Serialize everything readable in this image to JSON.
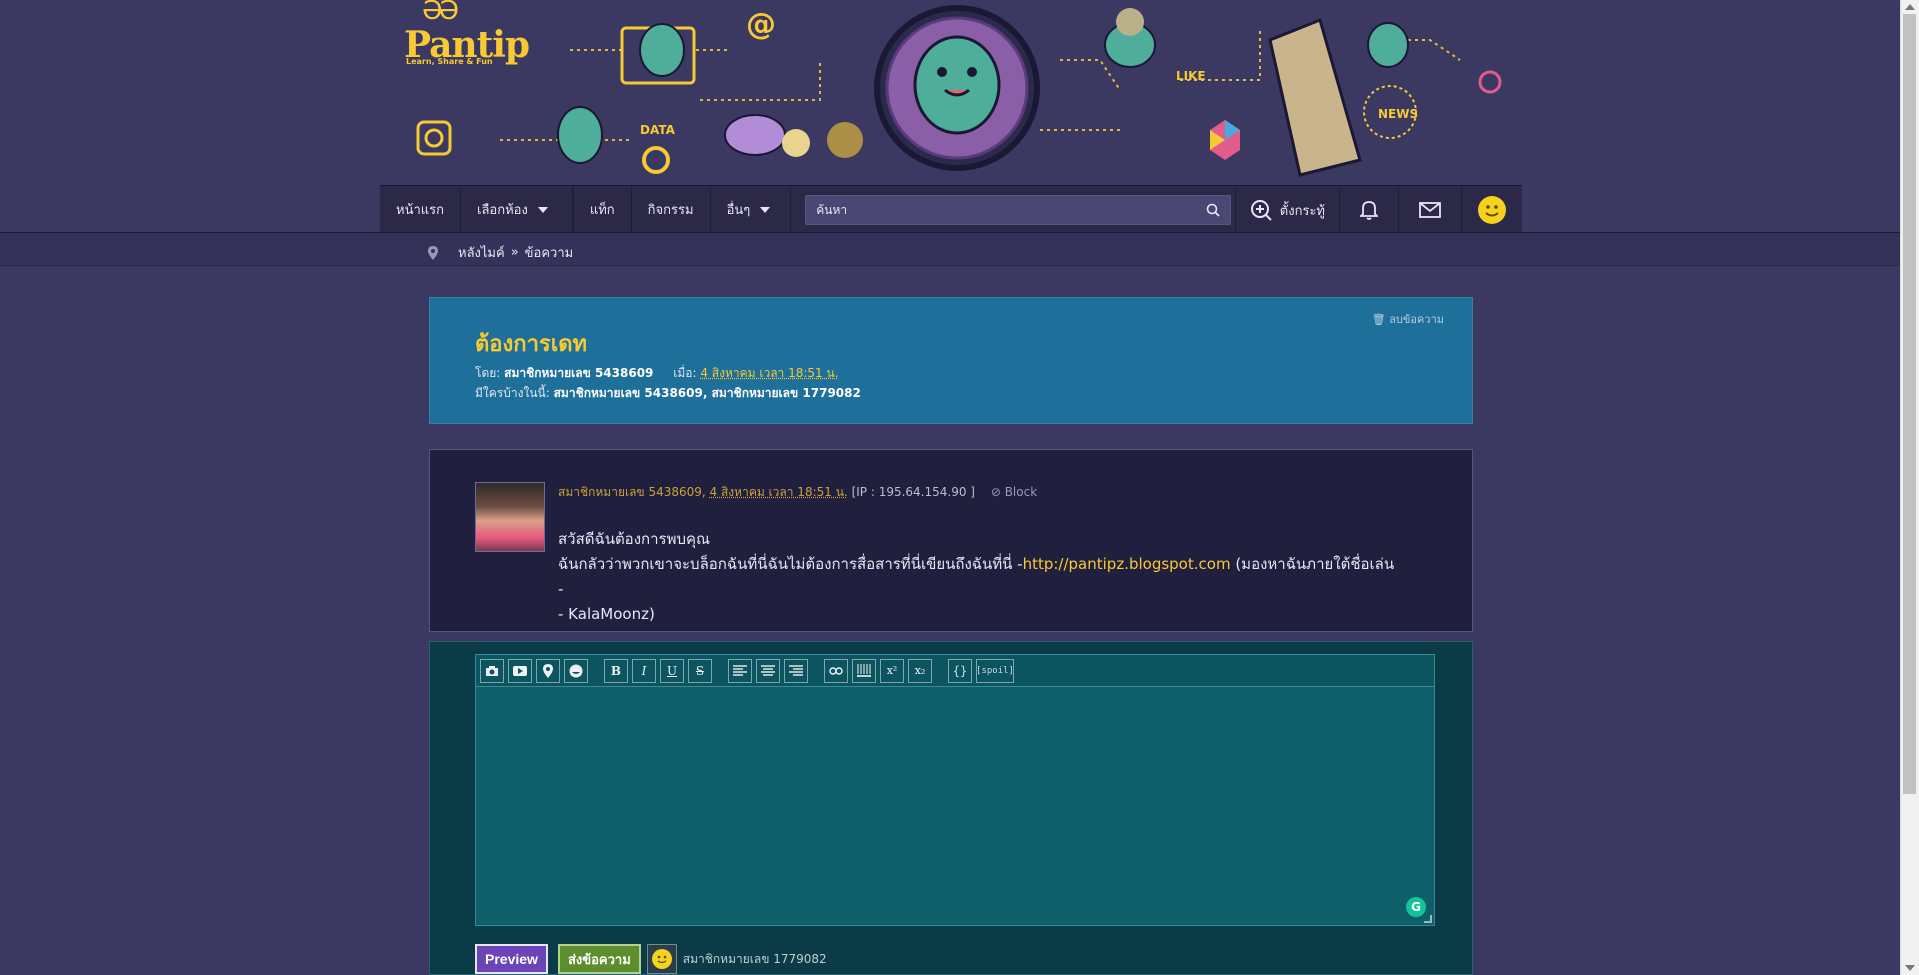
{
  "brand": {
    "name": "Pantip",
    "tagline": "Learn, Share & Fun",
    "eyes": "ƏƏ"
  },
  "colors": {
    "background": "#3b3861",
    "accent": "#f6c935",
    "topic_card": "#1e6f99",
    "reply_card": "#0b3b46"
  },
  "banner": {
    "labels": [
      "DATA",
      "LIKE",
      "NEWS",
      "@",
      "@"
    ]
  },
  "nav": {
    "home": "หน้าแรก",
    "select_room": "เลือกห้อง",
    "tags": "แท็ก",
    "activities": "กิจกรรม",
    "more": "อื่นๆ",
    "search_placeholder": "ค้นหา",
    "create_topic": "ตั้งกระทู้"
  },
  "breadcrumb": {
    "root": "หลังไมค์",
    "separator": "»",
    "current": "ข้อความ"
  },
  "topic": {
    "title": "ต้องการเดท",
    "by_label": "โดย:",
    "author": "สมาชิกหมายเลข 5438609",
    "when_label": "เมื่อ:",
    "date": "4 สิงหาคม เวลา 18:51 น.",
    "participants_label": "มีใครบ้างในนี้:",
    "participants": "สมาชิกหมายเลข 5438609, สมาชิกหมายเลข 1779082",
    "delete_label": "ลบข้อความ"
  },
  "post": {
    "author": "สมาชิกหมายเลข 5438609",
    "date": "4 สิงหาคม เวลา 18:51 น.",
    "ip": "[IP : 195.64.154.90 ]",
    "block_label": "Block",
    "line1": "สวัสดีฉันต้องการพบคุณ",
    "line2_prefix": "ฉันกลัวว่าพวกเขาจะบล็อกฉันที่นี่ฉันไม่ต้องการสื่อสารที่นี่เขียนถึงฉันที่นี่ -",
    "link": "http://pantipz.blogspot.com",
    "line2_suffix": " (มองหาฉันภายใต้ชื่อเล่น -",
    "line3": "- KalaMoonz)"
  },
  "editor": {
    "toolbar": [
      "camera-icon",
      "youtube-icon",
      "map-pin-icon",
      "emoji-icon",
      "B",
      "I",
      "U",
      "S",
      "align-left-icon",
      "align-center-icon",
      "align-right-icon",
      "link-icon",
      "hr-icon",
      "x2-sup",
      "x2-sub",
      "{}",
      "[spoil]"
    ],
    "bold": "B",
    "italic": "I",
    "underline": "U",
    "strike": "S",
    "superscript": "x²",
    "subscript": "x₂",
    "code": "{}",
    "spoil": "[spoil]",
    "value": "",
    "grammarly": "G"
  },
  "actions": {
    "preview": "Preview",
    "send": "ส่งข้อความ",
    "current_user": "สมาชิกหมายเลข 1779082"
  }
}
